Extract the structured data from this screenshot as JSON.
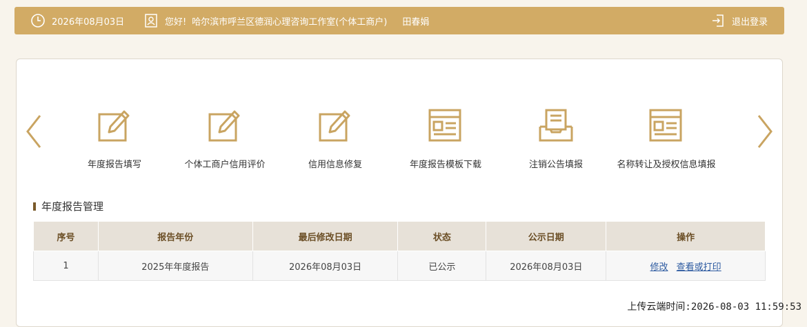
{
  "header": {
    "date": "2026年08月03日",
    "greeting": "您好!",
    "company": "哈尔滨市呼兰区德润心理咨询工作室(个体工商户)",
    "user": "田春娟",
    "logout_label": "退出登录",
    "accent_color": "#d2ab65"
  },
  "quick_menu": [
    {
      "label": "年度报告填写",
      "icon": "pencil-edit-icon"
    },
    {
      "label": "个体工商户信用评价",
      "icon": "pencil-edit-icon"
    },
    {
      "label": "信用信息修复",
      "icon": "pencil-edit-icon"
    },
    {
      "label": "年度报告模板下载",
      "icon": "template-document-icon"
    },
    {
      "label": "注销公告填报",
      "icon": "inbox-tray-icon"
    },
    {
      "label": "名称转让及授权信息填报",
      "icon": "template-document-icon"
    }
  ],
  "section": {
    "title": "年度报告管理"
  },
  "table": {
    "headers": [
      "序号",
      "报告年份",
      "最后修改日期",
      "状态",
      "公示日期",
      "操作"
    ],
    "rows": [
      {
        "index": "1",
        "year": "2025年年度报告",
        "modified": "2026年08月03日",
        "status": "已公示",
        "published": "2026年08月03日",
        "action_edit": "修改",
        "action_view": "查看或打印"
      }
    ]
  },
  "footer": {
    "upload_time": "上传云端时间:2026-08-03 11:59:53"
  }
}
